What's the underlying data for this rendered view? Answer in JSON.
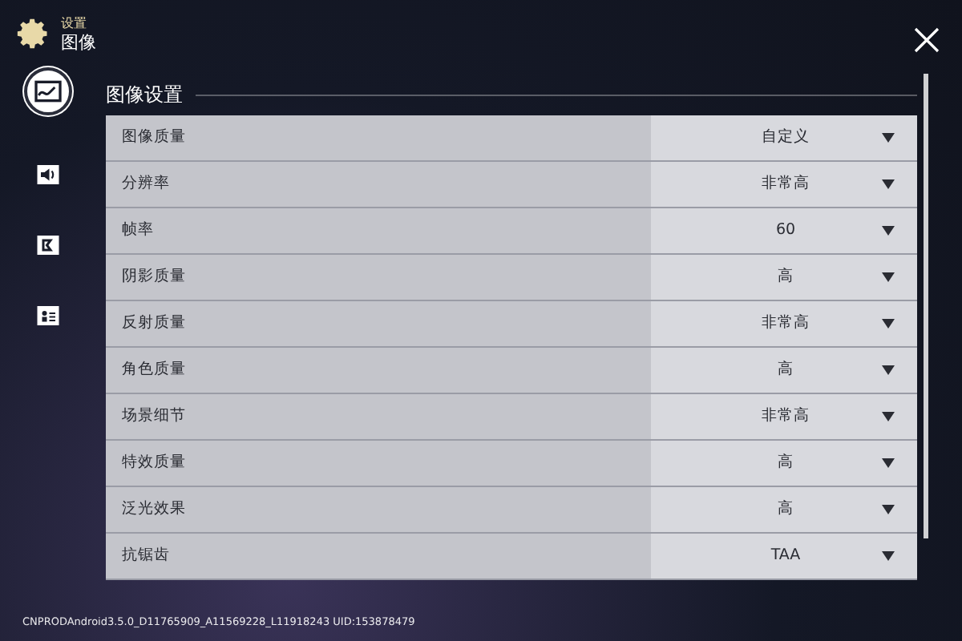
{
  "header": {
    "section": "设置",
    "page": "图像"
  },
  "sidebar": {
    "items": [
      {
        "kind": "image",
        "selected": true
      },
      {
        "kind": "sound",
        "selected": false
      },
      {
        "kind": "controls",
        "selected": false
      },
      {
        "kind": "account",
        "selected": false
      }
    ]
  },
  "panel": {
    "title": "图像设置",
    "rows": [
      {
        "label": "图像质量",
        "value": "自定义"
      },
      {
        "label": "分辨率",
        "value": "非常高"
      },
      {
        "label": "帧率",
        "value": "60"
      },
      {
        "label": "阴影质量",
        "value": "高"
      },
      {
        "label": "反射质量",
        "value": "非常高"
      },
      {
        "label": "角色质量",
        "value": "高"
      },
      {
        "label": "场景细节",
        "value": "非常高"
      },
      {
        "label": "特效质量",
        "value": "高"
      },
      {
        "label": "泛光效果",
        "value": "高"
      },
      {
        "label": "抗锯齿",
        "value": "TAA"
      }
    ]
  },
  "footer": {
    "build": "CNPRODAndroid3.5.0_D11765909_A11569228_L11918243 UID:153878479"
  }
}
